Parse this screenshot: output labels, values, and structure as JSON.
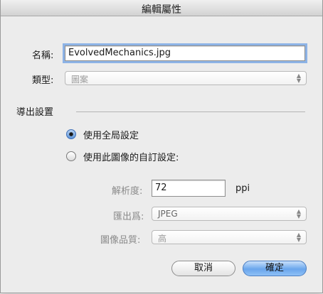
{
  "window": {
    "title": "編輯屬性"
  },
  "form": {
    "name_label": "名稱:",
    "name_value": "EvolvedMechanics.jpg",
    "type_label": "類型:",
    "type_value": "圖案"
  },
  "export": {
    "section_label": "導出設置",
    "radio_global": {
      "label": "使用全局設定",
      "selected": true
    },
    "radio_custom": {
      "label": "使用此圖像的自訂設定:",
      "selected": false
    },
    "resolution_label": "解析度:",
    "resolution_value": "72",
    "resolution_unit": "ppi",
    "export_as_label": "匯出爲:",
    "export_as_value": "JPEG",
    "quality_label": "圖像品質:",
    "quality_value": "高"
  },
  "buttons": {
    "cancel": "取消",
    "ok": "確定"
  },
  "icons": {
    "select_arrows": "▲▼"
  },
  "colors": {
    "accent": "#6aa6ec",
    "focus_ring": "#8db3e6"
  }
}
